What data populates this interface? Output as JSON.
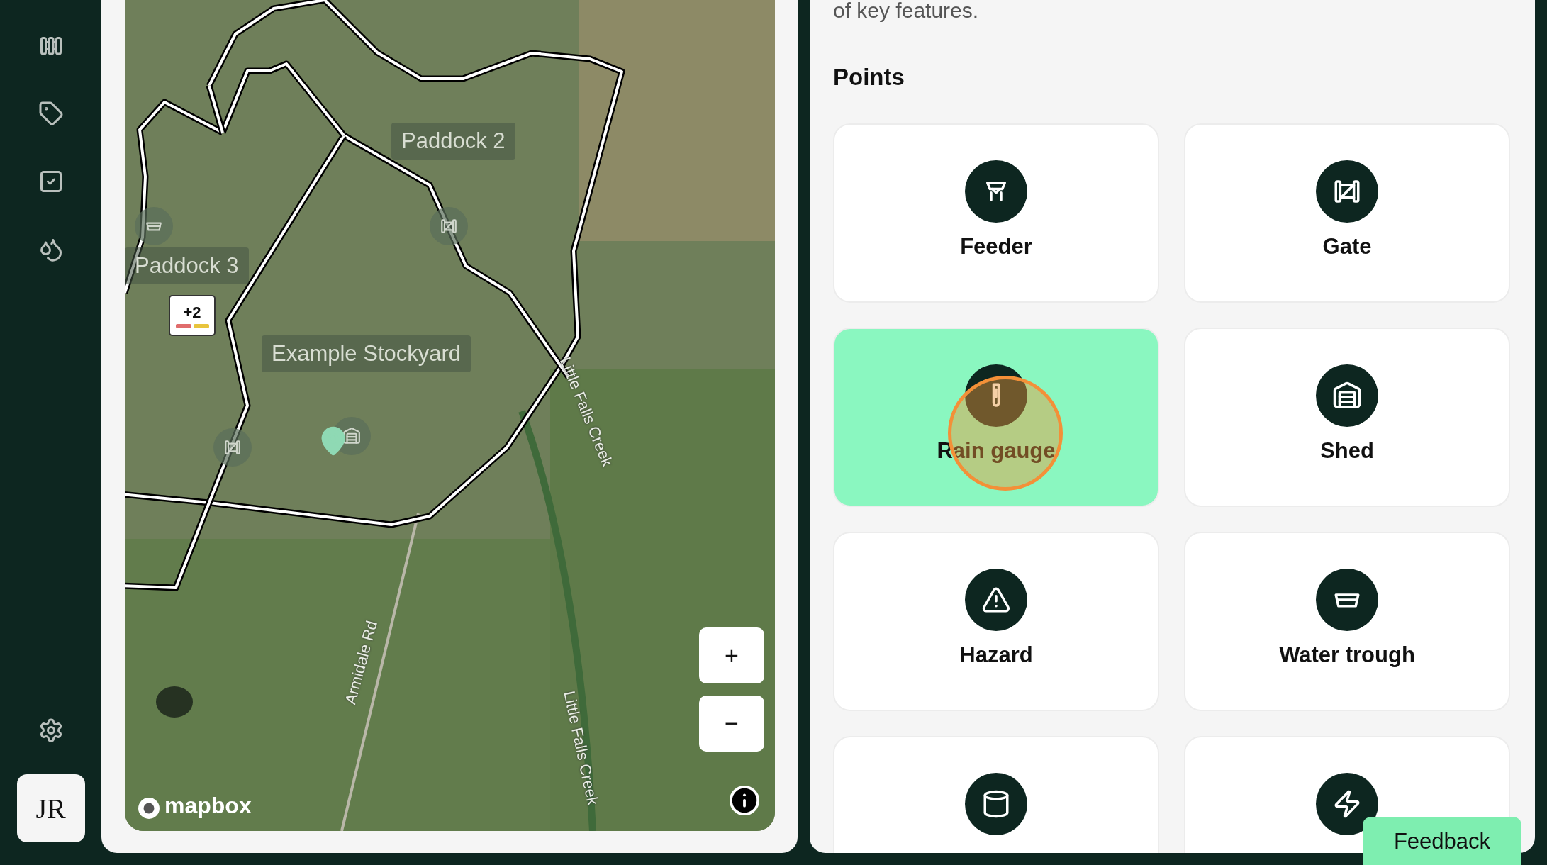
{
  "sidebar": {
    "nav": [
      {
        "kind": "fence"
      },
      {
        "kind": "tag"
      },
      {
        "kind": "checklist"
      },
      {
        "kind": "droplets"
      }
    ],
    "avatar": "JR"
  },
  "map": {
    "labels": [
      {
        "text": "Paddock 2",
        "kind": "area"
      },
      {
        "text": "Paddock 3",
        "kind": "area"
      },
      {
        "text": "Example Stockyard",
        "kind": "area"
      },
      {
        "text": "Little Falls Creek",
        "kind": "creek"
      },
      {
        "text": "Armidale Rd",
        "kind": "road"
      },
      {
        "text": "Little Falls Creek",
        "kind": "creek"
      }
    ],
    "markers": [
      {
        "kind": "trough"
      },
      {
        "kind": "gate"
      },
      {
        "kind": "gate"
      },
      {
        "kind": "shed"
      },
      {
        "kind": "pin"
      }
    ],
    "badge": {
      "text": "+2",
      "bars": [
        {
          "color": "#e06c6c"
        },
        {
          "color": "#e8c43c"
        }
      ]
    },
    "zoom_in": "+",
    "zoom_out": "−",
    "attribution": "mapbox"
  },
  "panel": {
    "intro": "of key features.",
    "heading": "Points",
    "points": [
      {
        "label": "Feeder",
        "kind": "feeder",
        "selected": false
      },
      {
        "label": "Gate",
        "kind": "gate",
        "selected": false
      },
      {
        "label": "Rain gauge",
        "kind": "raingauge",
        "selected": true
      },
      {
        "label": "Shed",
        "kind": "shed",
        "selected": false
      },
      {
        "label": "Hazard",
        "kind": "hazard",
        "selected": false
      },
      {
        "label": "Water trough",
        "kind": "trough",
        "selected": false
      },
      {
        "kind": "tank",
        "selected": false
      },
      {
        "kind": "power",
        "selected": false
      }
    ]
  },
  "feedback": "Feedback"
}
